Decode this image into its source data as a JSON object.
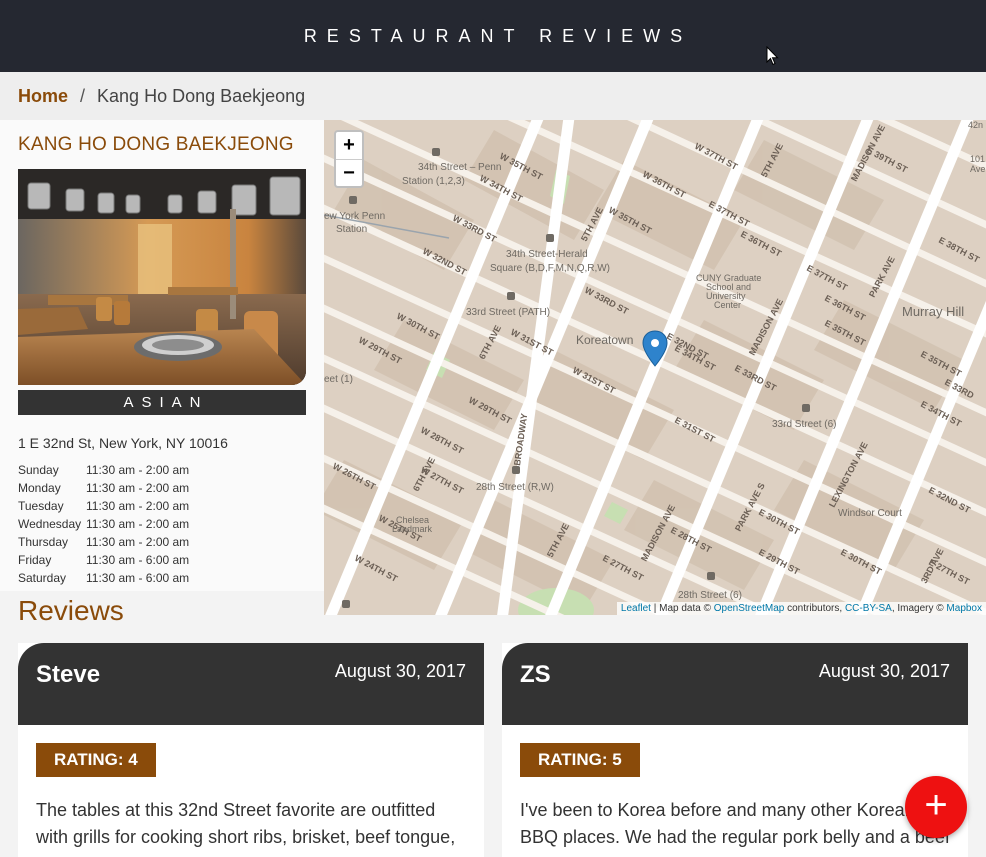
{
  "header": {
    "title": "RESTAURANT REVIEWS"
  },
  "breadcrumb": {
    "home": "Home",
    "separator": "/",
    "current": "Kang Ho Dong Baekjeong"
  },
  "restaurant": {
    "name": "KANG HO DONG BAEKJEONG",
    "cuisine": "ASIAN",
    "address": "1 E 32nd St, New York, NY 10016",
    "hours": [
      {
        "day": "Sunday",
        "time": "11:30 am - 2:00 am"
      },
      {
        "day": "Monday",
        "time": "11:30 am - 2:00 am"
      },
      {
        "day": "Tuesday",
        "time": "11:30 am - 2:00 am"
      },
      {
        "day": "Wednesday",
        "time": "11:30 am - 2:00 am"
      },
      {
        "day": "Thursday",
        "time": "11:30 am - 2:00 am"
      },
      {
        "day": "Friday",
        "time": "11:30 am - 6:00 am"
      },
      {
        "day": "Saturday",
        "time": "11:30 am - 6:00 am"
      }
    ]
  },
  "map": {
    "zoom_in": "+",
    "zoom_out": "−",
    "attribution": {
      "leaflet": "Leaflet",
      "map_data": " | Map data © ",
      "osm": "OpenStreetMap",
      "contributors": " contributors, ",
      "license": "CC-BY-SA",
      "imagery": ", Imagery © ",
      "mapbox": "Mapbox"
    },
    "labels": {
      "koreatown": "Koreatown",
      "murray_hill": "Murray Hill",
      "herald_sq": "34th Street-Herald",
      "herald_sq2": "Square (B,D,F,M,N,Q,R,W)",
      "penn1": "34th Street – Penn",
      "penn2": "Station (1,2,3)",
      "nyp1": "ew York Penn",
      "nyp2": "Station",
      "path33": "33rd Street (PATH)",
      "st33_6": "33rd Street (6)",
      "st28_rw": "28th Street (R,W)",
      "st28_6": "28th Street (6)",
      "cuny1": "CUNY Graduate",
      "cuny2": "School and",
      "cuny3": "University",
      "cuny4": "Center",
      "chelsea1": "Chelsea",
      "chelsea2": "Landmark",
      "windsor": "Windsor Court",
      "street_1": "eet (1)",
      "w35": "W 35TH ST",
      "w34": "W 34TH ST",
      "w33": "W 33RD ST",
      "w32": "W 32ND ST",
      "w31": "W 31ST ST",
      "w30": "W 30TH ST",
      "w29": "W 29TH ST",
      "w28": "W 28TH ST",
      "w27": "W 27TH ST",
      "w26": "W 26TH ST",
      "w25": "W 25TH ST",
      "w24": "W 24TH ST",
      "w37": "W 37TH ST",
      "w36": "W 36TH ST",
      "w35b": "W 35TH ST",
      "w33b": "W 33RD ST",
      "w30b": "W 30TH ST",
      "w29b": "W 29TH ST",
      "w24b": "W 24TH ST",
      "e37": "E 37TH ST",
      "e36": "E 36TH ST",
      "e35": "E 35TH ST",
      "e34": "E 34TH ST",
      "e33": "E 33RD ST",
      "e32": "E 32ND ST",
      "e31": "E 31ST ST",
      "e30": "E 30TH ST",
      "e29": "E 29TH ST",
      "e28": "E 28TH ST",
      "e27": "E 27TH ST",
      "e39": "E 39TH ST",
      "e38": "E 38TH ST",
      "e37b": "E 37TH ST",
      "e36b": "E 36TH ST",
      "e35b": "E 35TH ST",
      "e34b": "E 34TH ST",
      "e33b": "E 33RD ST",
      "e33c": "E 33RD",
      "e30b": "E 30TH ST",
      "e29b": "E 29TH ST",
      "e32b": "E 32ND ST",
      "e27b": "E 27TH ST",
      "ave6": "6TH AVE",
      "ave6b": "6TH AVE",
      "ave6c": "6TH AVE",
      "ave5": "5TH AVE",
      "ave5b": "5TH AVE",
      "ave5c": "5TH AVE",
      "madison": "MADISON AVE",
      "madison2": "MADISON AVE",
      "madison3": "MADISON AVE",
      "park": "PARK AVE",
      "park_s": "PARK AVE S",
      "lexington": "LEXINGTON AVE",
      "ave3": "3RD AVE",
      "broadway": "BROADWAY",
      "st42": "42n",
      "st101a": "101 P",
      "st101b": "Aven"
    }
  },
  "reviews": {
    "title": "Reviews",
    "items": [
      {
        "name": "Steve",
        "date": "August 30, 2017",
        "rating": "RATING: 4",
        "comments_line1": "The tables at this 32nd Street favorite are outfitted",
        "comments_line2": "with grills for cooking short ribs, brisket, beef tongue,"
      },
      {
        "name": "ZS",
        "date": "August 30, 2017",
        "rating": "RATING: 5",
        "comments_line1": "I've been to Korea before and many other Korean",
        "comments_line2": "BBQ places. We had the regular pork belly and a beef"
      }
    ]
  },
  "fab": {
    "label": "+"
  },
  "colors": {
    "accent": "#8a4b0a",
    "header_bg": "#252831",
    "fab": "#ee1111",
    "card_head": "#333333"
  }
}
